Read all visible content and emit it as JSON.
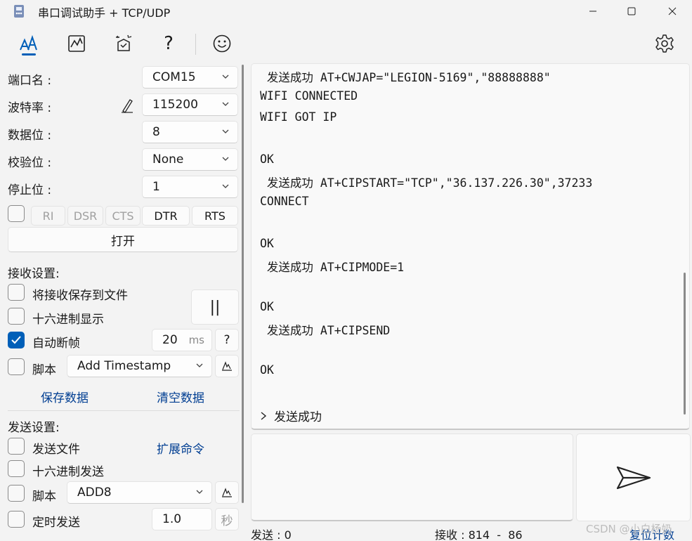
{
  "window": {
    "title": "串口调试助手 + TCP/UDP"
  },
  "toolbar": {
    "icons": [
      "text-mode-icon",
      "chart-icon",
      "sparkle-icon",
      "help-icon",
      "smiley-icon",
      "settings-gear-icon"
    ],
    "active_color": "#005fb8"
  },
  "serial": {
    "port_label": "端口名 :",
    "port_value": "COM15",
    "baud_label": "波特率 :",
    "baud_value": "115200",
    "databits_label": "数据位 :",
    "databits_value": "8",
    "parity_label": "校验位 :",
    "parity_value": "None",
    "stopbits_label": "停止位 :",
    "stopbits_value": "1",
    "pins": {
      "ri": "RI",
      "dsr": "DSR",
      "cts": "CTS",
      "dtr": "DTR",
      "rts": "RTS"
    },
    "open_button": "打开"
  },
  "receive": {
    "section_label": "接收设置:",
    "save_to_file": "将接收保存到文件",
    "hex_display": "十六进制显示",
    "auto_frame": "自动断帧",
    "auto_frame_checked": true,
    "frame_value": "20",
    "frame_unit": "ms",
    "help": "?",
    "script_label": "脚本",
    "script_value": "Add Timestamp",
    "pause_symbol": "||",
    "save_data": "保存数据",
    "clear_data": "清空数据"
  },
  "send": {
    "section_label": "发送设置:",
    "send_file": "发送文件",
    "extend_cmd": "扩展命令",
    "hex_send": "十六进制发送",
    "script_label": "脚本",
    "script_value": "ADD8",
    "timed_send": "定时发送",
    "timed_value": "1.0",
    "timed_unit": "秒"
  },
  "log": {
    "lines": [
      " 发送成功 AT+CWJAP=\"LEGION-5169\",\"88888888\"",
      "WIFI CONNECTED",
      "WIFI GOT IP",
      "",
      "OK",
      " 发送成功 AT+CIPSTART=\"TCP\",\"36.137.226.30\",37233",
      "CONNECT",
      "",
      "OK",
      " 发送成功 AT+CIPMODE=1",
      "",
      "OK",
      " 发送成功 AT+CIPSEND",
      "",
      "OK"
    ],
    "footer": "发送成功"
  },
  "status": {
    "sent": "发送 : 0",
    "received": "接收 : 814  -  86",
    "reset": "复位计数"
  },
  "watermark": "CSDN @小白杨奶"
}
